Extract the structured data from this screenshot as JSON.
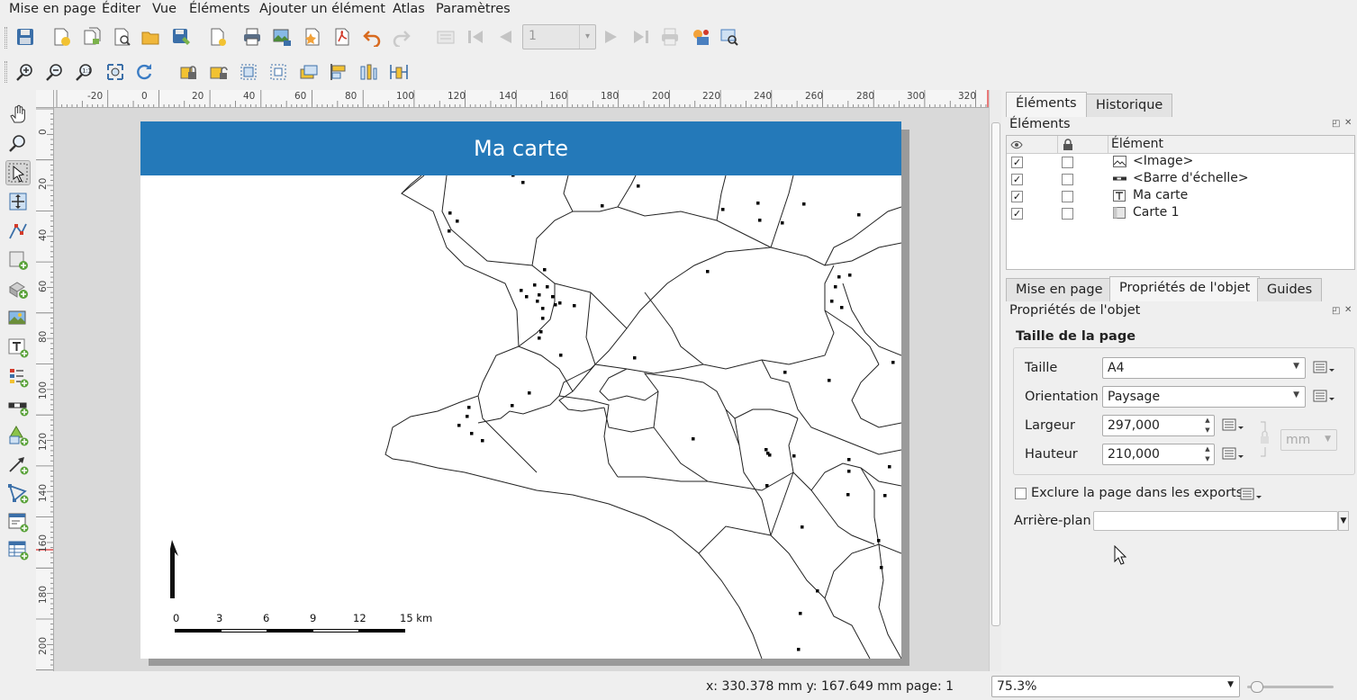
{
  "menu": [
    "Mise en page",
    "Éditer",
    "Vue",
    "Éléments",
    "Ajouter un élément",
    "Atlas",
    "Paramètres"
  ],
  "toolbar": {
    "atlas_page_value": "1"
  },
  "rulers": {
    "h_ticks": [
      "-20",
      "0",
      "20",
      "40",
      "60",
      "80",
      "100",
      "120",
      "140",
      "160",
      "180",
      "200",
      "220",
      "240",
      "260",
      "280",
      "300",
      "320"
    ],
    "v_ticks": [
      "0",
      "20",
      "40",
      "60",
      "80",
      "100",
      "120",
      "140",
      "160",
      "180",
      "200"
    ]
  },
  "layout": {
    "map_title": "Ma carte",
    "title_color": "#2479b9",
    "scalebar_labels": [
      "0",
      "3",
      "6",
      "9",
      "12",
      "15 km"
    ]
  },
  "dock": {
    "top_tabs": [
      "Éléments",
      "Historique"
    ],
    "items_panel_title": "Éléments",
    "items_header": "Élément",
    "items": [
      {
        "label": "<Image>",
        "visible": true,
        "locked": false,
        "icon": "image-item-icon"
      },
      {
        "label": "<Barre d'échelle>",
        "visible": true,
        "locked": false,
        "icon": "scalebar-item-icon"
      },
      {
        "label": "Ma carte",
        "visible": true,
        "locked": false,
        "icon": "label-item-icon"
      },
      {
        "label": "Carte 1",
        "visible": true,
        "locked": false,
        "icon": "map-item-icon"
      }
    ],
    "bottom_tabs": [
      "Mise en page",
      "Propriétés de l'objet",
      "Guides"
    ],
    "props_panel_title": "Propriétés de l'objet",
    "page_size_group": "Taille de la page",
    "size_label": "Taille",
    "size_value": "A4",
    "orientation_label": "Orientation",
    "orientation_value": "Paysage",
    "width_label": "Largeur",
    "width_value": "297,000",
    "height_label": "Hauteur",
    "height_value": "210,000",
    "unit_value": "mm",
    "exclude_label": "Exclure la page dans les exports",
    "background_label": "Arrière-plan"
  },
  "status": {
    "coords": "x: 330.378 mm  y: 167.649 mm  page: 1",
    "zoom": "75.3%",
    "zoom_slider_fraction": 0.05
  }
}
